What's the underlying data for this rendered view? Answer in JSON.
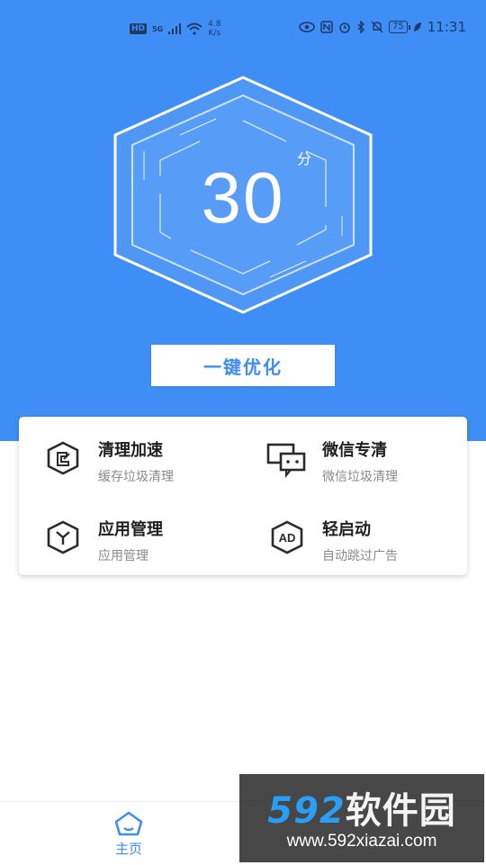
{
  "status_bar": {
    "hd": "HD",
    "network": "5G",
    "speed_value": "4.8",
    "speed_unit": "K/s",
    "battery": "75",
    "time": "11:31"
  },
  "score": {
    "value": "30",
    "unit": "分"
  },
  "optimize_button": "一键优化",
  "features": [
    {
      "title": "清理加速",
      "subtitle": "缓存垃圾清理",
      "icon": "broom-icon"
    },
    {
      "title": "微信专清",
      "subtitle": "微信垃圾清理",
      "icon": "chat-icon"
    },
    {
      "title": "应用管理",
      "subtitle": "应用管理",
      "icon": "app-manage-icon"
    },
    {
      "title": "轻启动",
      "subtitle": "自动跳过广告",
      "icon": "ad-icon"
    }
  ],
  "tabbar": {
    "home_label": "主页"
  },
  "watermark": {
    "logo_num": "592",
    "logo_text": "软件园",
    "url": "www.592xiazai.com"
  },
  "colors": {
    "primary": "#3f8ef5",
    "text": "#1f1f1f",
    "subtext": "#8a8a8a"
  }
}
